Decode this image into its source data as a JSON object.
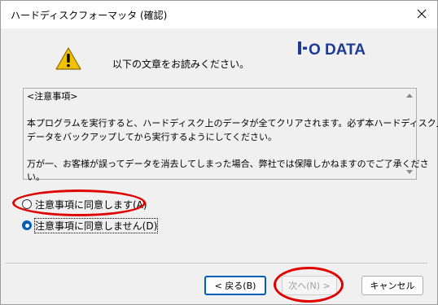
{
  "window": {
    "title": "ハードディスクフォーマッタ (確認)"
  },
  "dialog": {
    "instruction": "以下の文章をお読みください。",
    "logo_text": "I·O DATA",
    "notice_lines": [
      "<注意事項>",
      "",
      "本プログラムを実行すると、ハードディスク上のデータが全てクリアされます。必ず本ハードディスク上の",
      "データをバックアップしてから実行するようにしてください。",
      "",
      "万が一、お客様が誤ってデータを消去してしまった場合、弊社では保障しかねますのでご了承くださ",
      "い。"
    ],
    "options": [
      {
        "label": "注意事項に同意します(A)",
        "selected": false
      },
      {
        "label": "注意事項に同意しません(D)",
        "selected": true
      }
    ]
  },
  "buttons": {
    "back": "< 戻る(B)",
    "next": "次へ(N) >",
    "cancel": "キャンセル"
  },
  "colors": {
    "accent": "#005fb8",
    "annotation": "#e00000",
    "logo": "#1f3a93",
    "warning": "#f2c200"
  }
}
